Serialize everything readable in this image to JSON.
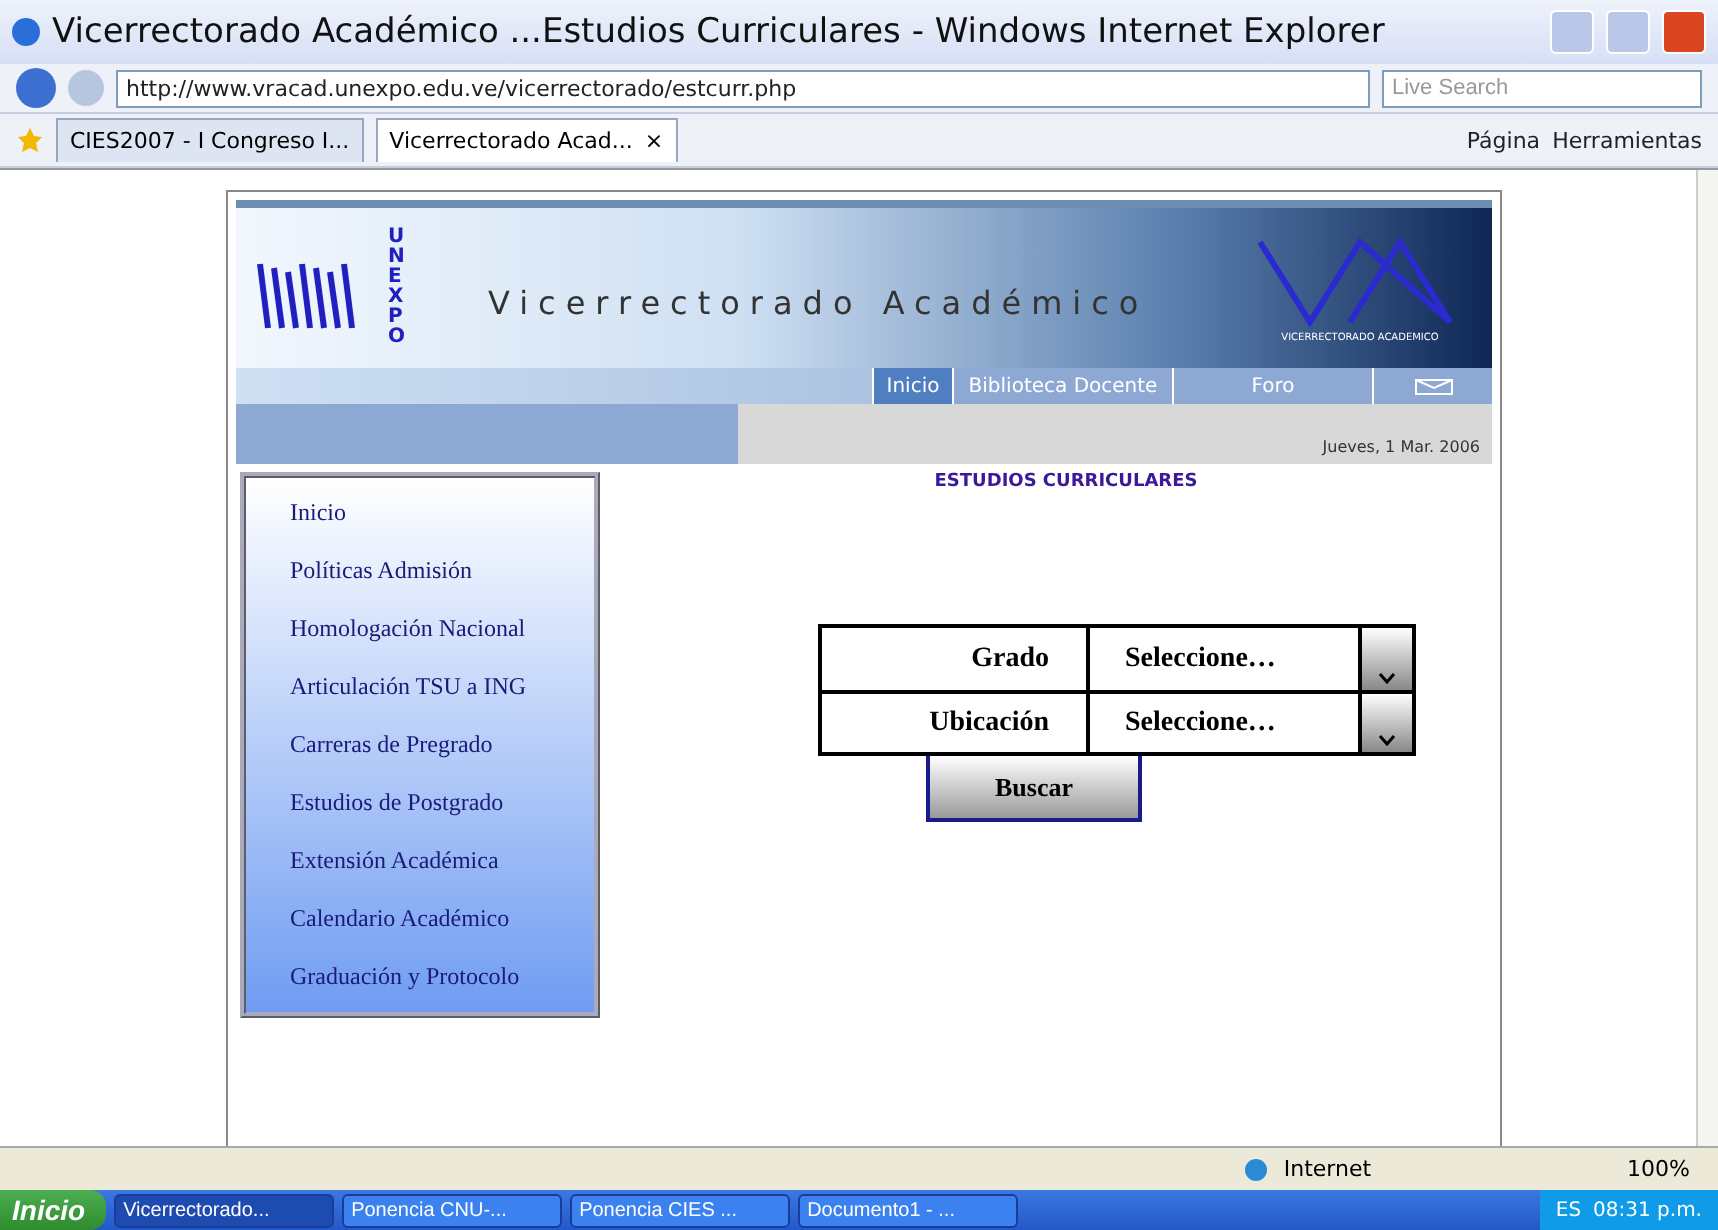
{
  "window": {
    "title": "Vicerrectorado Académico ...Estudios Curriculares - Windows Internet Explorer"
  },
  "address_bar": {
    "url": "http://www.vracad.unexpo.edu.ve/vicerrectorado/estcurr.php"
  },
  "search": {
    "placeholder": "Live Search"
  },
  "tabs": [
    {
      "label": "CIES2007 - I Congreso I...",
      "selected": false
    },
    {
      "label": "Vicerrectorado Acad...",
      "selected": true
    }
  ],
  "tab_close": "×",
  "command_bar": [
    "Página",
    "Herramientas"
  ],
  "page": {
    "logo_text": "UNEXPO",
    "site_title": "Vicerrectorado Académico",
    "emblem_caption": "VICERRECTORADO ACADEMICO",
    "nav": [
      {
        "label": "Inicio",
        "selected": true
      },
      {
        "label": "Biblioteca Docente",
        "selected": false
      },
      {
        "label": "Foro",
        "selected": false
      }
    ],
    "date": "Jueves, 1 Mar. 2006",
    "sidebar": [
      "Inicio",
      "Políticas Admisión",
      "Homologación Nacional",
      "Articulación TSU a ING",
      "Carreras de Pregrado",
      "Estudios de Postgrado",
      "Extensión Académica",
      "Calendario Académico",
      "Graduación y Protocolo"
    ],
    "section_title": "ESTUDIOS CURRICULARES",
    "form": [
      {
        "label": "Grado",
        "value": "Seleccione…"
      },
      {
        "label": "Ubicación",
        "value": "Seleccione…"
      }
    ],
    "submit": "Buscar"
  },
  "status_bar": {
    "zone": "Internet",
    "zoom": "100%"
  },
  "taskbar": {
    "start": "Inicio",
    "items": [
      {
        "label": "Vicerrectorado...",
        "selected": true
      },
      {
        "label": "Ponencia CNU-...",
        "selected": false
      },
      {
        "label": "Ponencia CIES ...",
        "selected": false
      },
      {
        "label": "Documento1 - ...",
        "selected": false
      }
    ],
    "language": "ES",
    "clock": "08:31 p.m."
  }
}
